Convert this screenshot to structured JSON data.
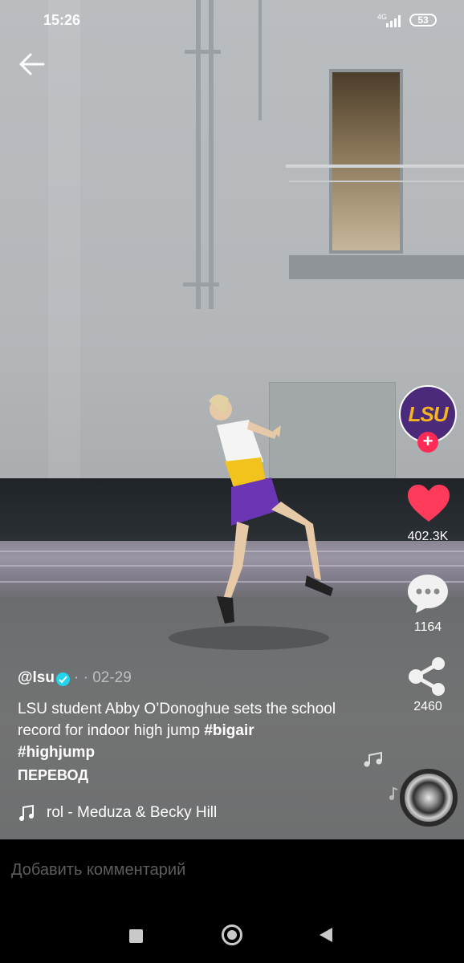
{
  "status_bar": {
    "time": "15:26",
    "network": "4G",
    "battery": "53"
  },
  "video": {
    "description_icon": "video-frame"
  },
  "sidebar": {
    "avatar_text": "LSU",
    "follow_symbol": "+",
    "likes": "402.3K",
    "comments": "1164",
    "shares": "2460",
    "like_color": "#ff3b5c"
  },
  "post": {
    "username": "@lsu",
    "date": "· · 02-29",
    "caption": "LSU student Abby O’Donoghue sets the school record for indoor high jump ",
    "tag1": "#bigair",
    "tag2": "#highjump",
    "translate_label": "ПЕРЕВОД",
    "music": "rol - Meduza & Becky Hill"
  },
  "comment_bar": {
    "placeholder": "Добавить комментарий"
  }
}
